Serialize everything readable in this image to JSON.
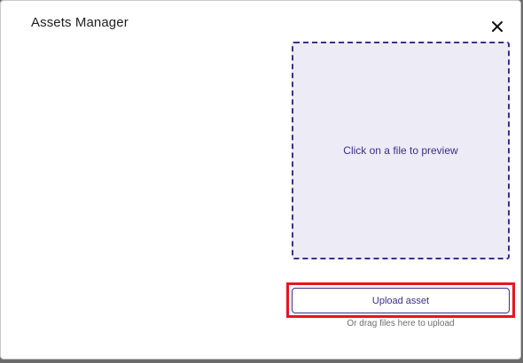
{
  "modal": {
    "title": "Assets Manager",
    "close_icon": "close-icon"
  },
  "preview": {
    "placeholder": "Click on a file to preview"
  },
  "upload": {
    "button_label": "Upload asset",
    "drag_hint": "Or drag files here to upload"
  },
  "colors": {
    "accent": "#3d2e8c",
    "preview_bg": "#ecebf6",
    "highlight": "#e8141f"
  }
}
